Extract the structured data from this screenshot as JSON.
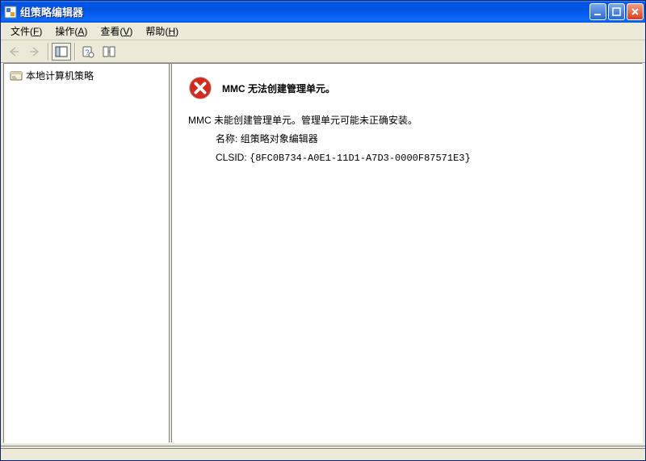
{
  "window": {
    "title": "组策略编辑器"
  },
  "menu": {
    "file": {
      "label": "文件",
      "accel": "F"
    },
    "action": {
      "label": "操作",
      "accel": "A"
    },
    "view": {
      "label": "查看",
      "accel": "V"
    },
    "help": {
      "label": "帮助",
      "accel": "H"
    }
  },
  "toolbar": {
    "back": {
      "name": "back-button",
      "enabled": false
    },
    "forward": {
      "name": "forward-button",
      "enabled": false
    },
    "pane": {
      "name": "toggle-tree-button",
      "active": true
    },
    "refresh": {
      "name": "refresh-button"
    },
    "extra": {
      "name": "properties-button"
    }
  },
  "tree": {
    "root": {
      "label": "本地计算机策略"
    }
  },
  "error": {
    "title_prefix": "MMC",
    "title_text": "无法创建管理单元。",
    "line1_prefix": "MMC",
    "line1_text": "未能创建管理单元。管理单元可能未正确安装。",
    "name_label": "名称:",
    "name_value": "组策略对象编辑器",
    "clsid_label": "CLSID:",
    "clsid_value": "{8FC0B734-A0E1-11D1-A7D3-0000F87571E3}"
  },
  "colors": {
    "titlebar": "#0054e3",
    "close": "#d4401c",
    "chrome": "#ece9d8"
  }
}
